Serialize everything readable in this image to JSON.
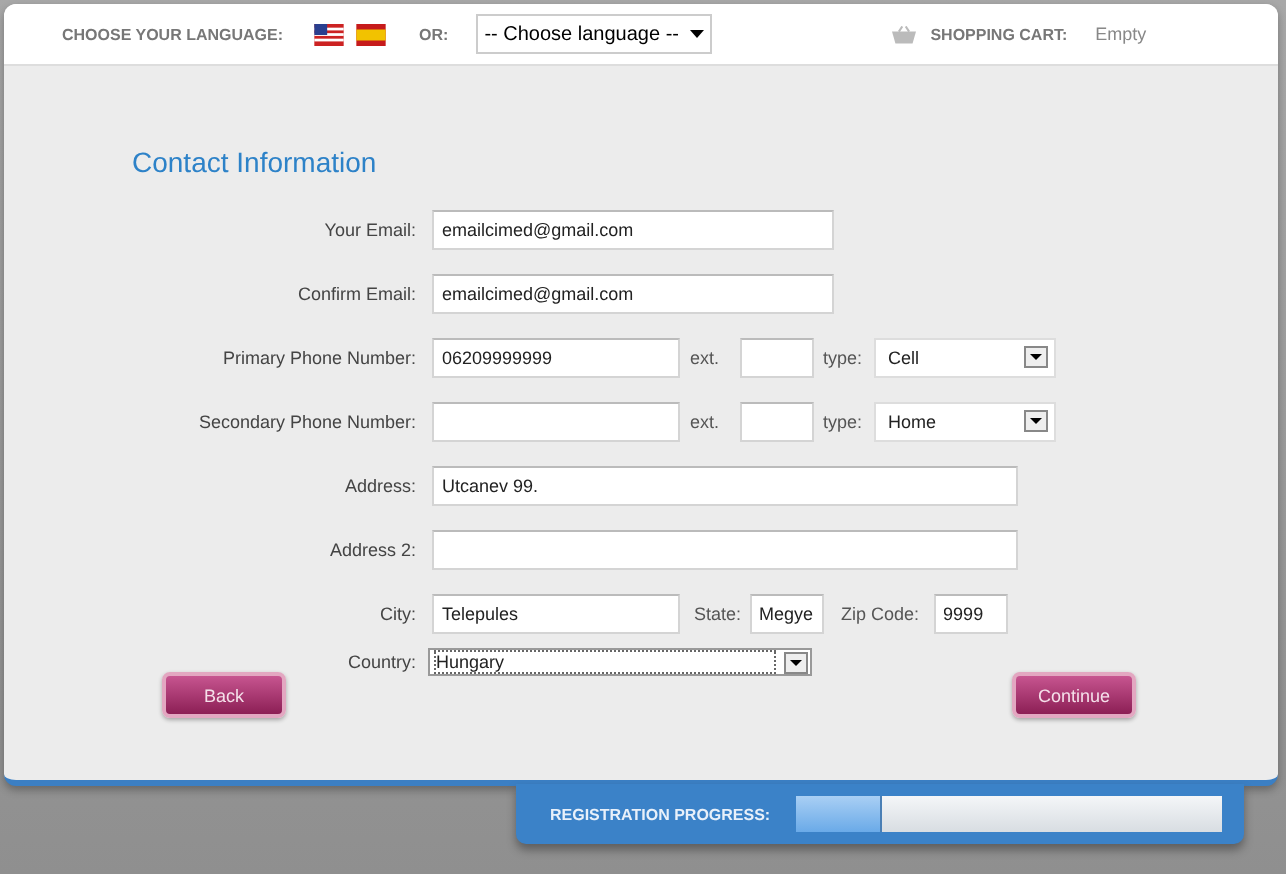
{
  "header": {
    "language_label": "CHOOSE YOUR LANGUAGE:",
    "or_label": "OR:",
    "language_select": "-- Choose language --",
    "cart_label": "SHOPPING CART:",
    "cart_value": "Empty"
  },
  "form": {
    "title": "Contact Information",
    "email": {
      "label": "Your Email:",
      "value": "emailcimed@gmail.com"
    },
    "confirm_email": {
      "label": "Confirm Email:",
      "value": "emailcimed@gmail.com"
    },
    "primary_phone": {
      "label": "Primary Phone Number:",
      "value": "06209999999",
      "ext_label": "ext.",
      "type_label": "type:",
      "type": "Cell"
    },
    "secondary_phone": {
      "label": "Secondary Phone Number:",
      "ext_label": "ext.",
      "type_label": "type:",
      "type": "Home"
    },
    "address": {
      "label": "Address:",
      "value": "Utcanev 99."
    },
    "address_2": {
      "label": "Address 2:"
    },
    "city": {
      "label": "City:",
      "value": "Telepules"
    },
    "state": {
      "label": "State:",
      "value": "Megye"
    },
    "zip_code": {
      "label": "Zip Code:",
      "value": "9999"
    },
    "country": {
      "label": "Country:",
      "value": "Hungary"
    }
  },
  "buttons": {
    "back": "Back",
    "continue": "Continue"
  },
  "progress": {
    "label": "REGISTRATION PROGRESS:",
    "level": 0.2
  }
}
